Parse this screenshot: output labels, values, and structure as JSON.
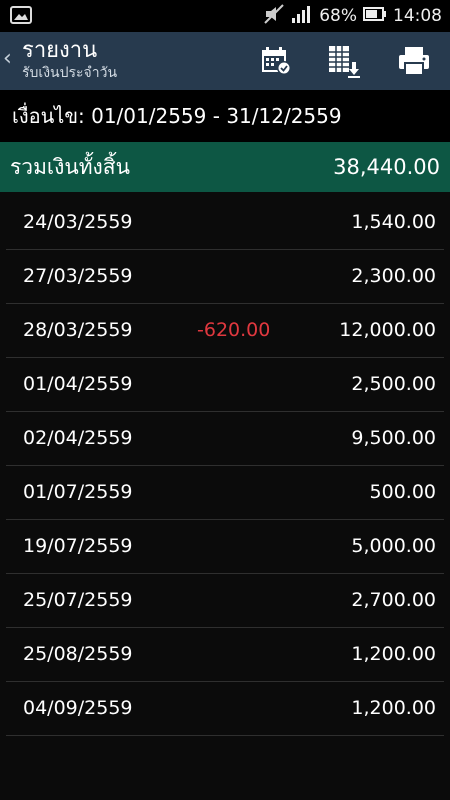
{
  "status_bar": {
    "battery_percent": "68%",
    "time": "14:08"
  },
  "app_bar": {
    "title": "รายงาน",
    "subtitle": "รับเงินประจำวัน",
    "back_glyph": "‹"
  },
  "filter": {
    "label": "เงื่อนไข: 01/01/2559 - 31/12/2559"
  },
  "total": {
    "label": "รวมเงินทั้งสิ้น",
    "value": "38,440.00"
  },
  "rows": [
    {
      "date": "24/03/2559",
      "negative": "",
      "amount": "1,540.00"
    },
    {
      "date": "27/03/2559",
      "negative": "",
      "amount": "2,300.00"
    },
    {
      "date": "28/03/2559",
      "negative": "-620.00",
      "amount": "12,000.00"
    },
    {
      "date": "01/04/2559",
      "negative": "",
      "amount": "2,500.00"
    },
    {
      "date": "02/04/2559",
      "negative": "",
      "amount": "9,500.00"
    },
    {
      "date": "01/07/2559",
      "negative": "",
      "amount": "500.00"
    },
    {
      "date": "19/07/2559",
      "negative": "",
      "amount": "5,000.00"
    },
    {
      "date": "25/07/2559",
      "negative": "",
      "amount": "2,700.00"
    },
    {
      "date": "25/08/2559",
      "negative": "",
      "amount": "1,200.00"
    },
    {
      "date": "04/09/2559",
      "negative": "",
      "amount": "1,200.00"
    }
  ],
  "icons": {
    "notification": "image-icon",
    "mute": "mute-icon",
    "signal": "signal-icon",
    "battery": "battery-icon",
    "calendar": "calendar-check-icon",
    "export": "spreadsheet-download-icon",
    "print": "printer-icon"
  },
  "colors": {
    "app_bar": "#273a4e",
    "total_bar": "#0d5744",
    "negative": "#e0383f",
    "background": "#0b0b0b"
  }
}
